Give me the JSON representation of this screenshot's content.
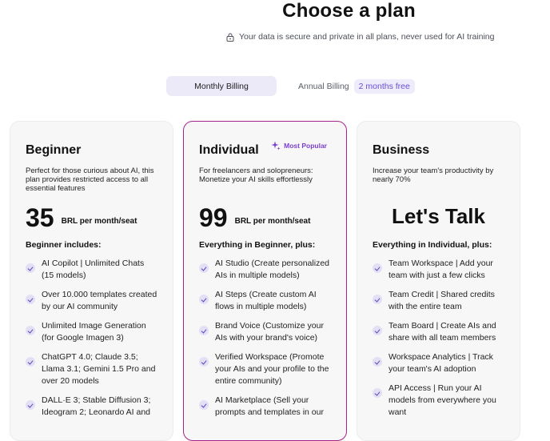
{
  "header": {
    "title": "Choose a plan",
    "secure_note": "Your data is secure and private in all plans, never used for AI training"
  },
  "billing": {
    "monthly_label": "Monthly Billing",
    "annual_label": "Annual Billing",
    "annual_badge": "2 months free"
  },
  "plans": [
    {
      "name": "Beginner",
      "description": "Perfect for those curious about AI, this plan provides restricted access to all essential features",
      "price": "35",
      "price_unit": "BRL per month/seat",
      "includes_heading": "Beginner includes:",
      "features": [
        "AI Copilot | Unlimited Chats (15 models)",
        "Over 10.000 templates created by our AI community",
        "Unlimited Image Generation (for Google Imagen 3)",
        "ChatGPT 4.0; Claude 3.5; Llama 3.1; Gemini 1.5 Pro and over 20 models",
        "DALL·E 3; Stable Diffusion 3; Ideogram 2; Leonardo AI and"
      ]
    },
    {
      "name": "Individual",
      "badge": "Most Popular",
      "description": "For freelancers and solopreneurs: Monetize your AI skills effortlessly",
      "price": "99",
      "price_unit": "BRL per month/seat",
      "includes_heading": "Everything in Beginner, plus:",
      "features": [
        "AI Studio (Create personalized AIs in multiple models)",
        "AI Steps (Create custom AI flows in multiple models)",
        "Brand Voice (Customize your AIs with your brand's voice)",
        "Verified Workspace (Promote your AIs and your profile to the entire community)",
        "AI Marketplace (Sell your prompts and templates in our"
      ]
    },
    {
      "name": "Business",
      "description": "Increase your team's productivity by nearly 70%",
      "price": "Let's Talk",
      "includes_heading": "Everything in Individual, plus:",
      "features": [
        "Team Workspace | Add your team with just a few clicks",
        "Team Credit | Shared credits with the entire team",
        "Team Board | Create AIs and share with all team members",
        "Workspace Analytics | Track your team's AI adoption",
        "API Access | Run your AI models from everywhere you want"
      ]
    }
  ],
  "icons": {
    "lock": "lock-icon",
    "sparkle": "sparkle-icon",
    "check": "check-icon"
  },
  "colors": {
    "accent": "#a5228a",
    "badge_text": "#7b3fd0",
    "tab_bg": "#ece9f8"
  }
}
